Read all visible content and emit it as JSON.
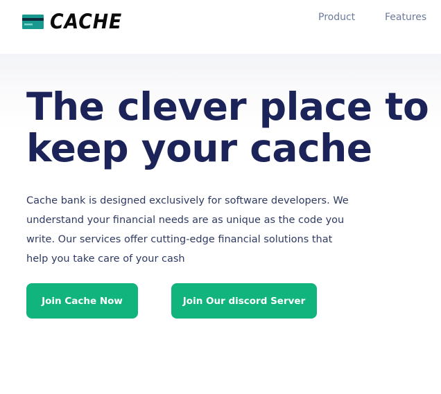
{
  "header": {
    "logo_text": "CACHE",
    "logo_icon": "credit-card-icon",
    "nav": [
      {
        "label": "Product"
      },
      {
        "label": "Features"
      }
    ]
  },
  "hero": {
    "headline": "The clever place to keep your cache",
    "description": "Cache bank is designed exclusively for software developers. We understand your financial needs are as unique as the code you write. Our services offer cutting-edge financial solutions that help you take care of your cash",
    "primary_button": "Join Cache Now",
    "secondary_button": "Join Our discord Server"
  },
  "colors": {
    "headline": "#1b2359",
    "accent": "#12b47d",
    "nav_text": "#6c7a9c",
    "body_text": "#2f3a62"
  }
}
